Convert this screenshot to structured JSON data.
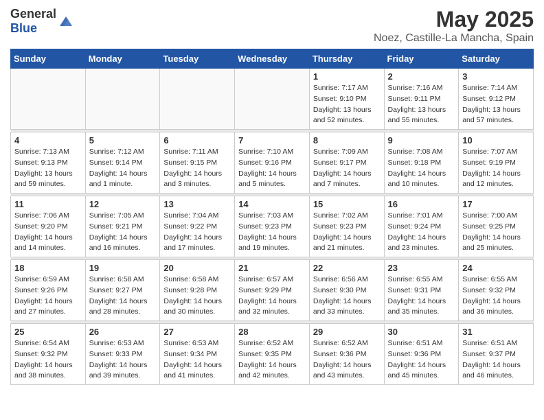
{
  "header": {
    "logo_general": "General",
    "logo_blue": "Blue",
    "title": "May 2025",
    "location": "Noez, Castille-La Mancha, Spain"
  },
  "weekdays": [
    "Sunday",
    "Monday",
    "Tuesday",
    "Wednesday",
    "Thursday",
    "Friday",
    "Saturday"
  ],
  "weeks": [
    [
      {
        "day": "",
        "info": ""
      },
      {
        "day": "",
        "info": ""
      },
      {
        "day": "",
        "info": ""
      },
      {
        "day": "",
        "info": ""
      },
      {
        "day": "1",
        "info": "Sunrise: 7:17 AM\nSunset: 9:10 PM\nDaylight: 13 hours and 52 minutes."
      },
      {
        "day": "2",
        "info": "Sunrise: 7:16 AM\nSunset: 9:11 PM\nDaylight: 13 hours and 55 minutes."
      },
      {
        "day": "3",
        "info": "Sunrise: 7:14 AM\nSunset: 9:12 PM\nDaylight: 13 hours and 57 minutes."
      }
    ],
    [
      {
        "day": "4",
        "info": "Sunrise: 7:13 AM\nSunset: 9:13 PM\nDaylight: 13 hours and 59 minutes."
      },
      {
        "day": "5",
        "info": "Sunrise: 7:12 AM\nSunset: 9:14 PM\nDaylight: 14 hours and 1 minute."
      },
      {
        "day": "6",
        "info": "Sunrise: 7:11 AM\nSunset: 9:15 PM\nDaylight: 14 hours and 3 minutes."
      },
      {
        "day": "7",
        "info": "Sunrise: 7:10 AM\nSunset: 9:16 PM\nDaylight: 14 hours and 5 minutes."
      },
      {
        "day": "8",
        "info": "Sunrise: 7:09 AM\nSunset: 9:17 PM\nDaylight: 14 hours and 7 minutes."
      },
      {
        "day": "9",
        "info": "Sunrise: 7:08 AM\nSunset: 9:18 PM\nDaylight: 14 hours and 10 minutes."
      },
      {
        "day": "10",
        "info": "Sunrise: 7:07 AM\nSunset: 9:19 PM\nDaylight: 14 hours and 12 minutes."
      }
    ],
    [
      {
        "day": "11",
        "info": "Sunrise: 7:06 AM\nSunset: 9:20 PM\nDaylight: 14 hours and 14 minutes."
      },
      {
        "day": "12",
        "info": "Sunrise: 7:05 AM\nSunset: 9:21 PM\nDaylight: 14 hours and 16 minutes."
      },
      {
        "day": "13",
        "info": "Sunrise: 7:04 AM\nSunset: 9:22 PM\nDaylight: 14 hours and 17 minutes."
      },
      {
        "day": "14",
        "info": "Sunrise: 7:03 AM\nSunset: 9:23 PM\nDaylight: 14 hours and 19 minutes."
      },
      {
        "day": "15",
        "info": "Sunrise: 7:02 AM\nSunset: 9:23 PM\nDaylight: 14 hours and 21 minutes."
      },
      {
        "day": "16",
        "info": "Sunrise: 7:01 AM\nSunset: 9:24 PM\nDaylight: 14 hours and 23 minutes."
      },
      {
        "day": "17",
        "info": "Sunrise: 7:00 AM\nSunset: 9:25 PM\nDaylight: 14 hours and 25 minutes."
      }
    ],
    [
      {
        "day": "18",
        "info": "Sunrise: 6:59 AM\nSunset: 9:26 PM\nDaylight: 14 hours and 27 minutes."
      },
      {
        "day": "19",
        "info": "Sunrise: 6:58 AM\nSunset: 9:27 PM\nDaylight: 14 hours and 28 minutes."
      },
      {
        "day": "20",
        "info": "Sunrise: 6:58 AM\nSunset: 9:28 PM\nDaylight: 14 hours and 30 minutes."
      },
      {
        "day": "21",
        "info": "Sunrise: 6:57 AM\nSunset: 9:29 PM\nDaylight: 14 hours and 32 minutes."
      },
      {
        "day": "22",
        "info": "Sunrise: 6:56 AM\nSunset: 9:30 PM\nDaylight: 14 hours and 33 minutes."
      },
      {
        "day": "23",
        "info": "Sunrise: 6:55 AM\nSunset: 9:31 PM\nDaylight: 14 hours and 35 minutes."
      },
      {
        "day": "24",
        "info": "Sunrise: 6:55 AM\nSunset: 9:32 PM\nDaylight: 14 hours and 36 minutes."
      }
    ],
    [
      {
        "day": "25",
        "info": "Sunrise: 6:54 AM\nSunset: 9:32 PM\nDaylight: 14 hours and 38 minutes."
      },
      {
        "day": "26",
        "info": "Sunrise: 6:53 AM\nSunset: 9:33 PM\nDaylight: 14 hours and 39 minutes."
      },
      {
        "day": "27",
        "info": "Sunrise: 6:53 AM\nSunset: 9:34 PM\nDaylight: 14 hours and 41 minutes."
      },
      {
        "day": "28",
        "info": "Sunrise: 6:52 AM\nSunset: 9:35 PM\nDaylight: 14 hours and 42 minutes."
      },
      {
        "day": "29",
        "info": "Sunrise: 6:52 AM\nSunset: 9:36 PM\nDaylight: 14 hours and 43 minutes."
      },
      {
        "day": "30",
        "info": "Sunrise: 6:51 AM\nSunset: 9:36 PM\nDaylight: 14 hours and 45 minutes."
      },
      {
        "day": "31",
        "info": "Sunrise: 6:51 AM\nSunset: 9:37 PM\nDaylight: 14 hours and 46 minutes."
      }
    ]
  ]
}
